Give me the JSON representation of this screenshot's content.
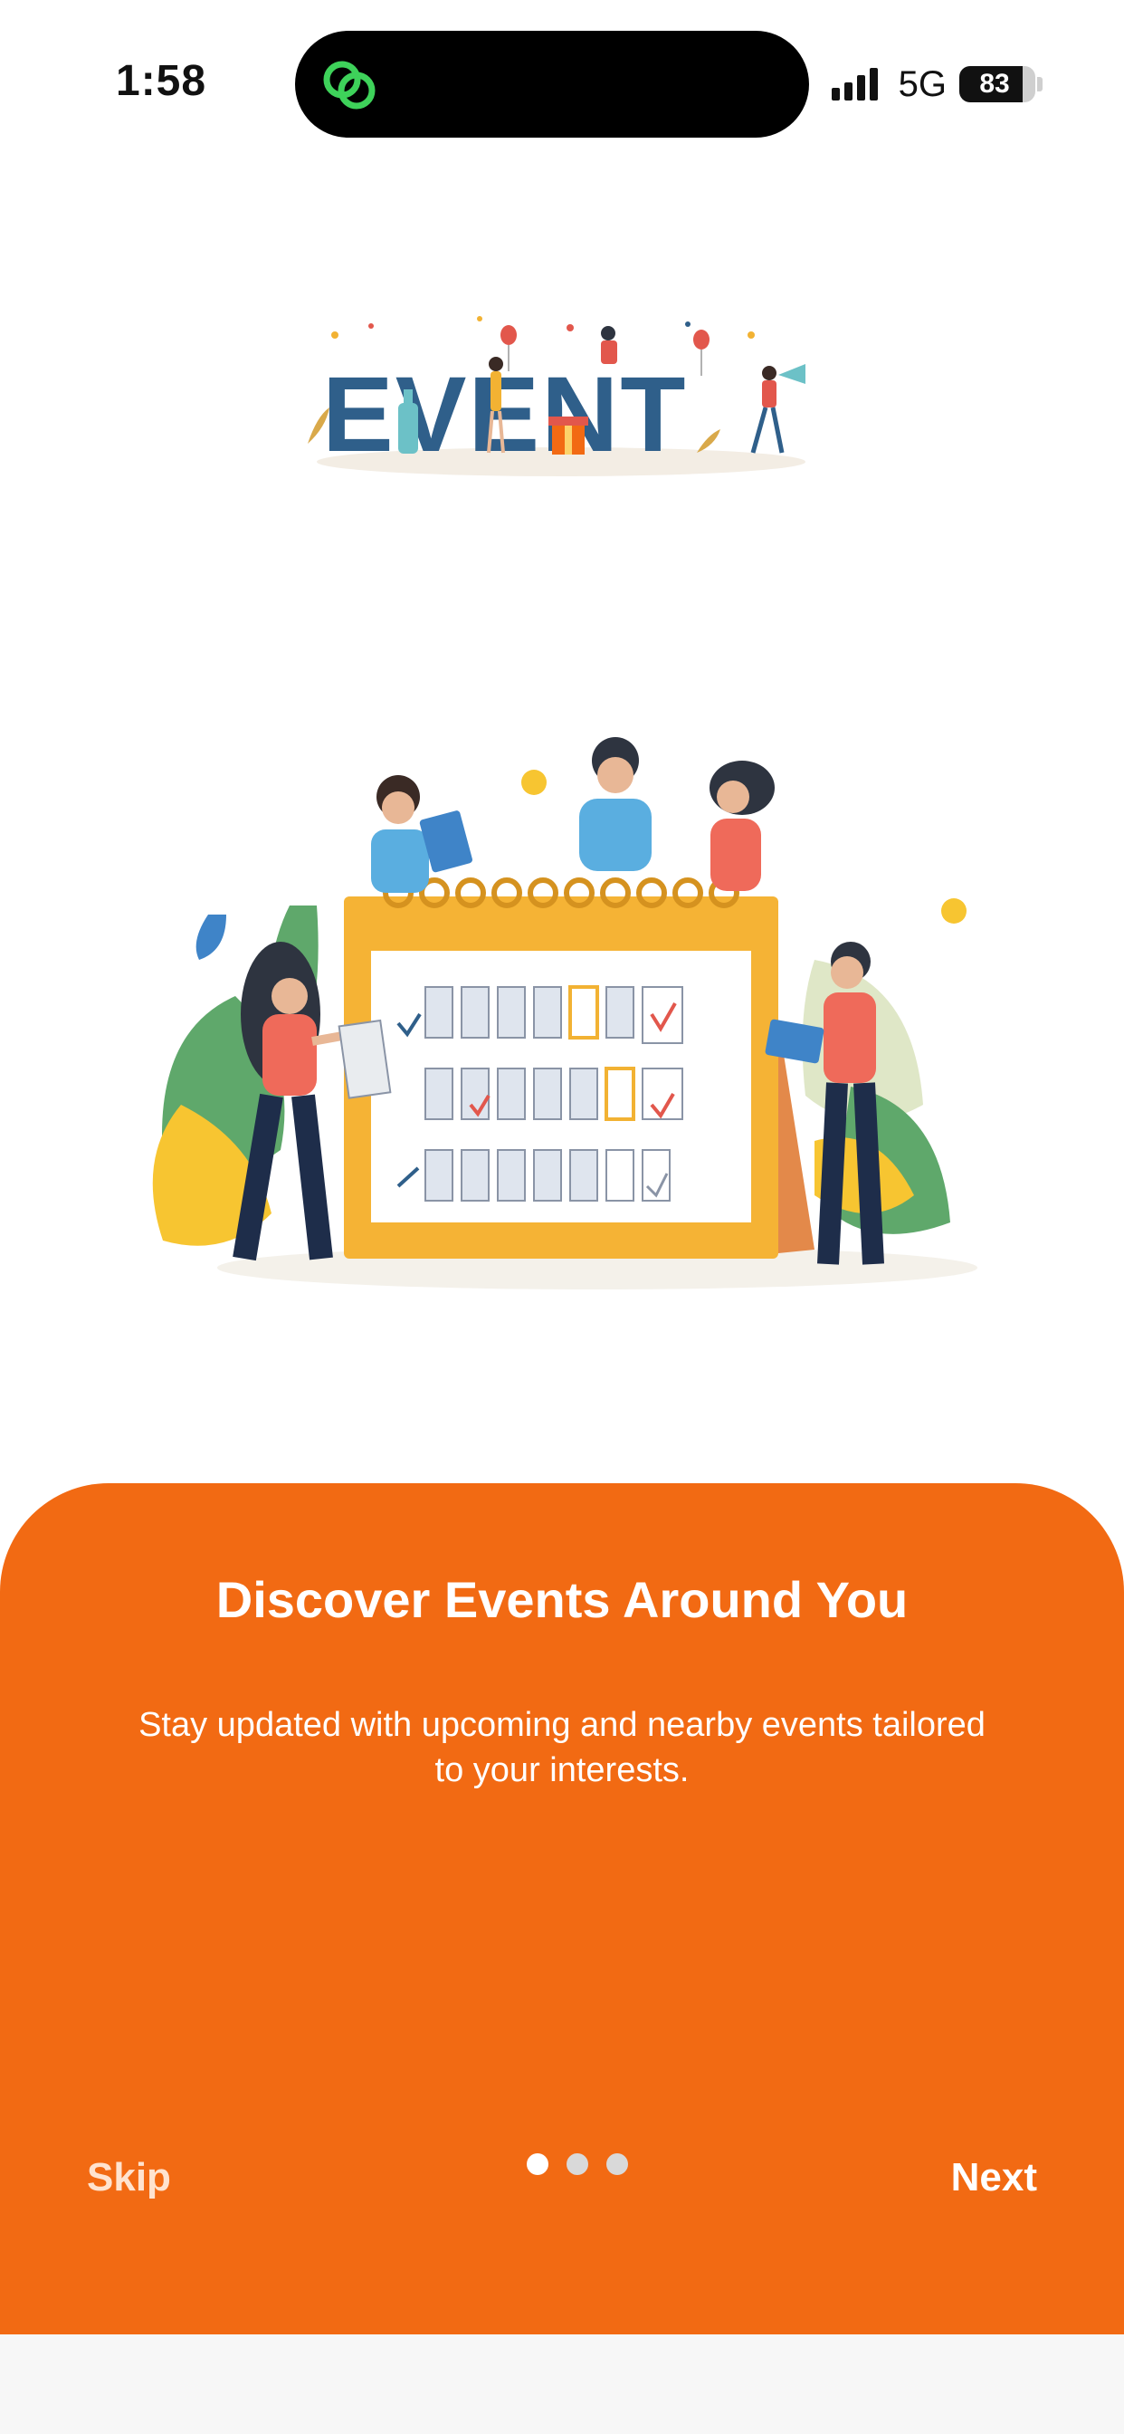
{
  "status_bar": {
    "time": "1:58",
    "network": "5G",
    "battery_level": "83"
  },
  "icons": {
    "island_app": "link-rings-icon",
    "signal": "signal-bars-icon",
    "battery": "battery-icon"
  },
  "logo": {
    "text": "EVENT"
  },
  "onboarding": {
    "title": "Discover Events Around You",
    "subtitle": "Stay updated with upcoming and nearby events tailored to your interests.",
    "skip_label": "Skip",
    "next_label": "Next",
    "page_count": 3,
    "current_page": 1
  },
  "colors": {
    "accent": "#f26a13",
    "logo_text": "#2f5f8a",
    "calendar": "#f5b335"
  }
}
